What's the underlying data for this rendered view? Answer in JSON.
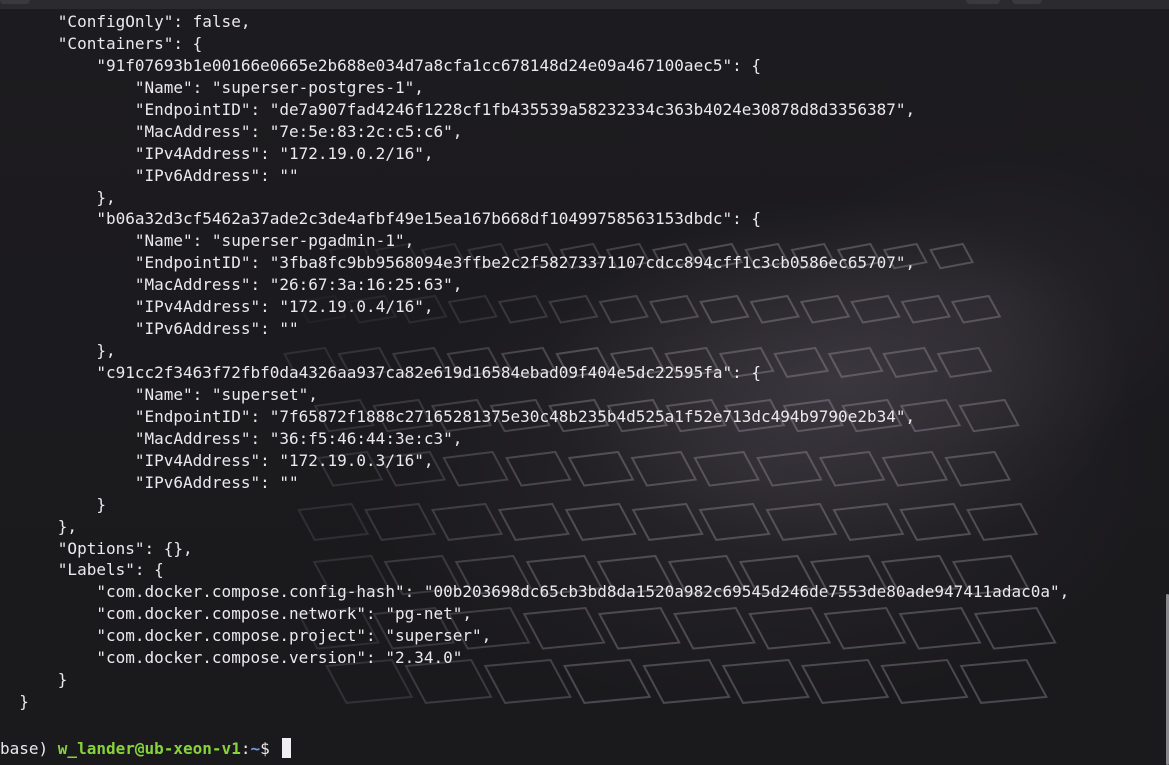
{
  "terminal": {
    "lines": [
      "      \"ConfigOnly\": false,",
      "      \"Containers\": {",
      "          \"91f07693b1e00166e0665e2b688e034d7a8cfa1cc678148d24e09a467100aec5\": {",
      "              \"Name\": \"superser-postgres-1\",",
      "              \"EndpointID\": \"de7a907fad4246f1228cf1fb435539a58232334c363b4024e30878d8d3356387\",",
      "              \"MacAddress\": \"7e:5e:83:2c:c5:c6\",",
      "              \"IPv4Address\": \"172.19.0.2/16\",",
      "              \"IPv6Address\": \"\"",
      "          },",
      "          \"b06a32d3cf5462a37ade2c3de4afbf49e15ea167b668df10499758563153dbdc\": {",
      "              \"Name\": \"superser-pgadmin-1\",",
      "              \"EndpointID\": \"3fba8fc9bb9568094e3ffbe2c2f58273371107cdcc894cff1c3cb0586ec65707\",",
      "              \"MacAddress\": \"26:67:3a:16:25:63\",",
      "              \"IPv4Address\": \"172.19.0.4/16\",",
      "              \"IPv6Address\": \"\"",
      "          },",
      "          \"c91cc2f3463f72fbf0da4326aa937ca82e619d16584ebad09f404e5dc22595fa\": {",
      "              \"Name\": \"superset\",",
      "              \"EndpointID\": \"7f65872f1888c27165281375e30c48b235b4d525a1f52e713dc494b9790e2b34\",",
      "              \"MacAddress\": \"36:f5:46:44:3e:c3\",",
      "              \"IPv4Address\": \"172.19.0.3/16\",",
      "              \"IPv6Address\": \"\"",
      "          }",
      "      },",
      "      \"Options\": {},",
      "      \"Labels\": {",
      "          \"com.docker.compose.config-hash\": \"00b203698dc65cb3bd8da1520a982c69545d246de7553de80ade947411adac0a\",",
      "          \"com.docker.compose.network\": \"pg-net\",",
      "          \"com.docker.compose.project\": \"superser\",",
      "          \"com.docker.compose.version\": \"2.34.0\"",
      "      }",
      "  }"
    ],
    "prompt": {
      "env": "base) ",
      "user_host": "w_lander@ub-xeon-v1",
      "separator": ":",
      "path": "~",
      "symbol": "$ "
    }
  },
  "colors": {
    "background": "#1b1a1d",
    "text": "#ece9ee",
    "user_host": "#86d43a",
    "path": "#6f9be0"
  }
}
